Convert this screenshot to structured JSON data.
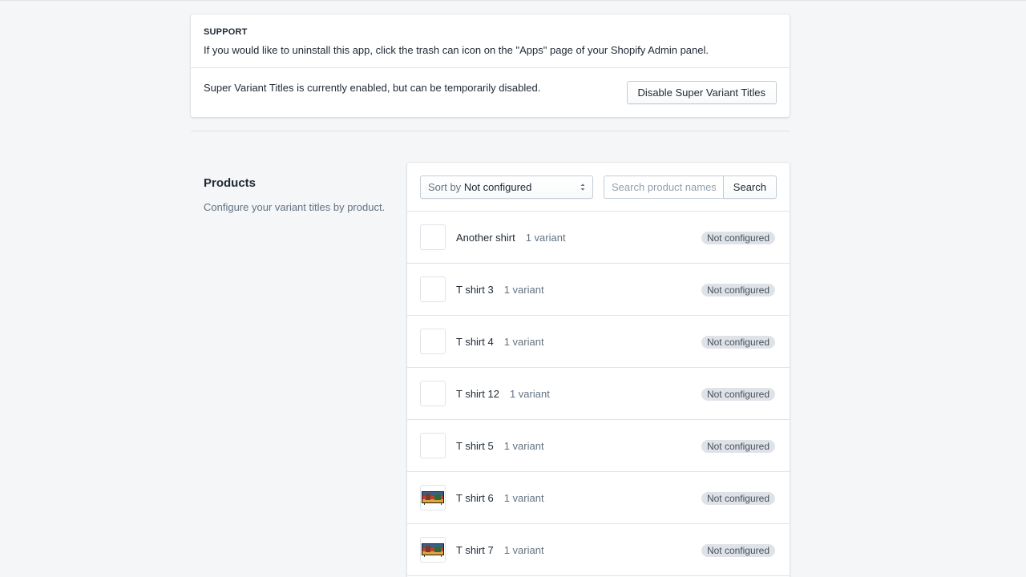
{
  "support": {
    "heading": "SUPPORT",
    "text": "If you would like to uninstall this app, click the trash can icon on the \"Apps\" page of your Shopify Admin panel."
  },
  "status": {
    "text": "Super Variant Titles is currently enabled, but can be temporarily disabled.",
    "disable_button": "Disable Super Variant Titles"
  },
  "products_section": {
    "title": "Products",
    "description": "Configure your variant titles by product."
  },
  "filters": {
    "sort_prefix": "Sort by",
    "sort_value": "Not configured",
    "search_placeholder": "Search product names",
    "search_button": "Search"
  },
  "products": [
    {
      "name": "Another shirt",
      "variants": "1 variant",
      "status": "Not configured",
      "image": "blank"
    },
    {
      "name": "T shirt 3",
      "variants": "1 variant",
      "status": "Not configured",
      "image": "blank"
    },
    {
      "name": "T shirt 4",
      "variants": "1 variant",
      "status": "Not configured",
      "image": "blank"
    },
    {
      "name": "T shirt 12",
      "variants": "1 variant",
      "status": "Not configured",
      "image": "blank"
    },
    {
      "name": "T shirt 5",
      "variants": "1 variant",
      "status": "Not configured",
      "image": "blank"
    },
    {
      "name": "T shirt 6",
      "variants": "1 variant",
      "status": "Not configured",
      "image": "tv"
    },
    {
      "name": "T shirt 7",
      "variants": "1 variant",
      "status": "Not configured",
      "image": "tv"
    }
  ]
}
